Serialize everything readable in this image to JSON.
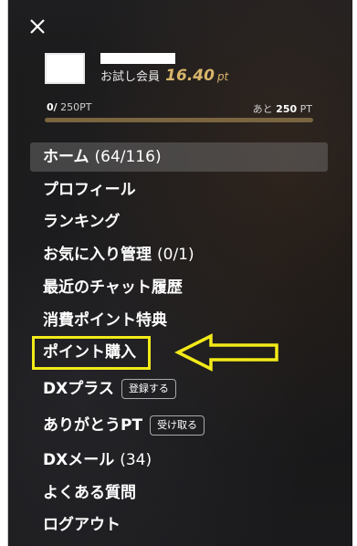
{
  "close_icon": "close-icon",
  "profile": {
    "member_label": "お試し会員",
    "points_value": "16.40",
    "points_unit": "pt"
  },
  "progress": {
    "current": "0/",
    "max_label": "250PT",
    "remaining_prefix": "あと",
    "remaining_value": "250",
    "remaining_unit": "PT",
    "fraction": 0
  },
  "menu": {
    "home": {
      "label": "ホーム",
      "count": "(64/116)"
    },
    "profile": {
      "label": "プロフィール"
    },
    "ranking": {
      "label": "ランキング"
    },
    "favorites": {
      "label": "お気に入り管理",
      "count": "(0/1)"
    },
    "chat_history": {
      "label": "最近のチャット履歴"
    },
    "point_benefits": {
      "label": "消費ポイント特典"
    },
    "buy_points": {
      "label": "ポイント購入"
    },
    "dx_plus": {
      "label": "DXプラス",
      "button": "登録する"
    },
    "thanks_pt": {
      "label": "ありがとうPT",
      "button": "受け取る"
    },
    "dx_mail": {
      "label": "DXメール",
      "count": "(34)"
    },
    "faq": {
      "label": "よくある質問"
    },
    "logout": {
      "label": "ログアウト"
    }
  },
  "colors": {
    "accent_gold": "#d8b56a",
    "highlight_yellow": "#f2ea18",
    "active_bg": "#5a5a5a"
  }
}
